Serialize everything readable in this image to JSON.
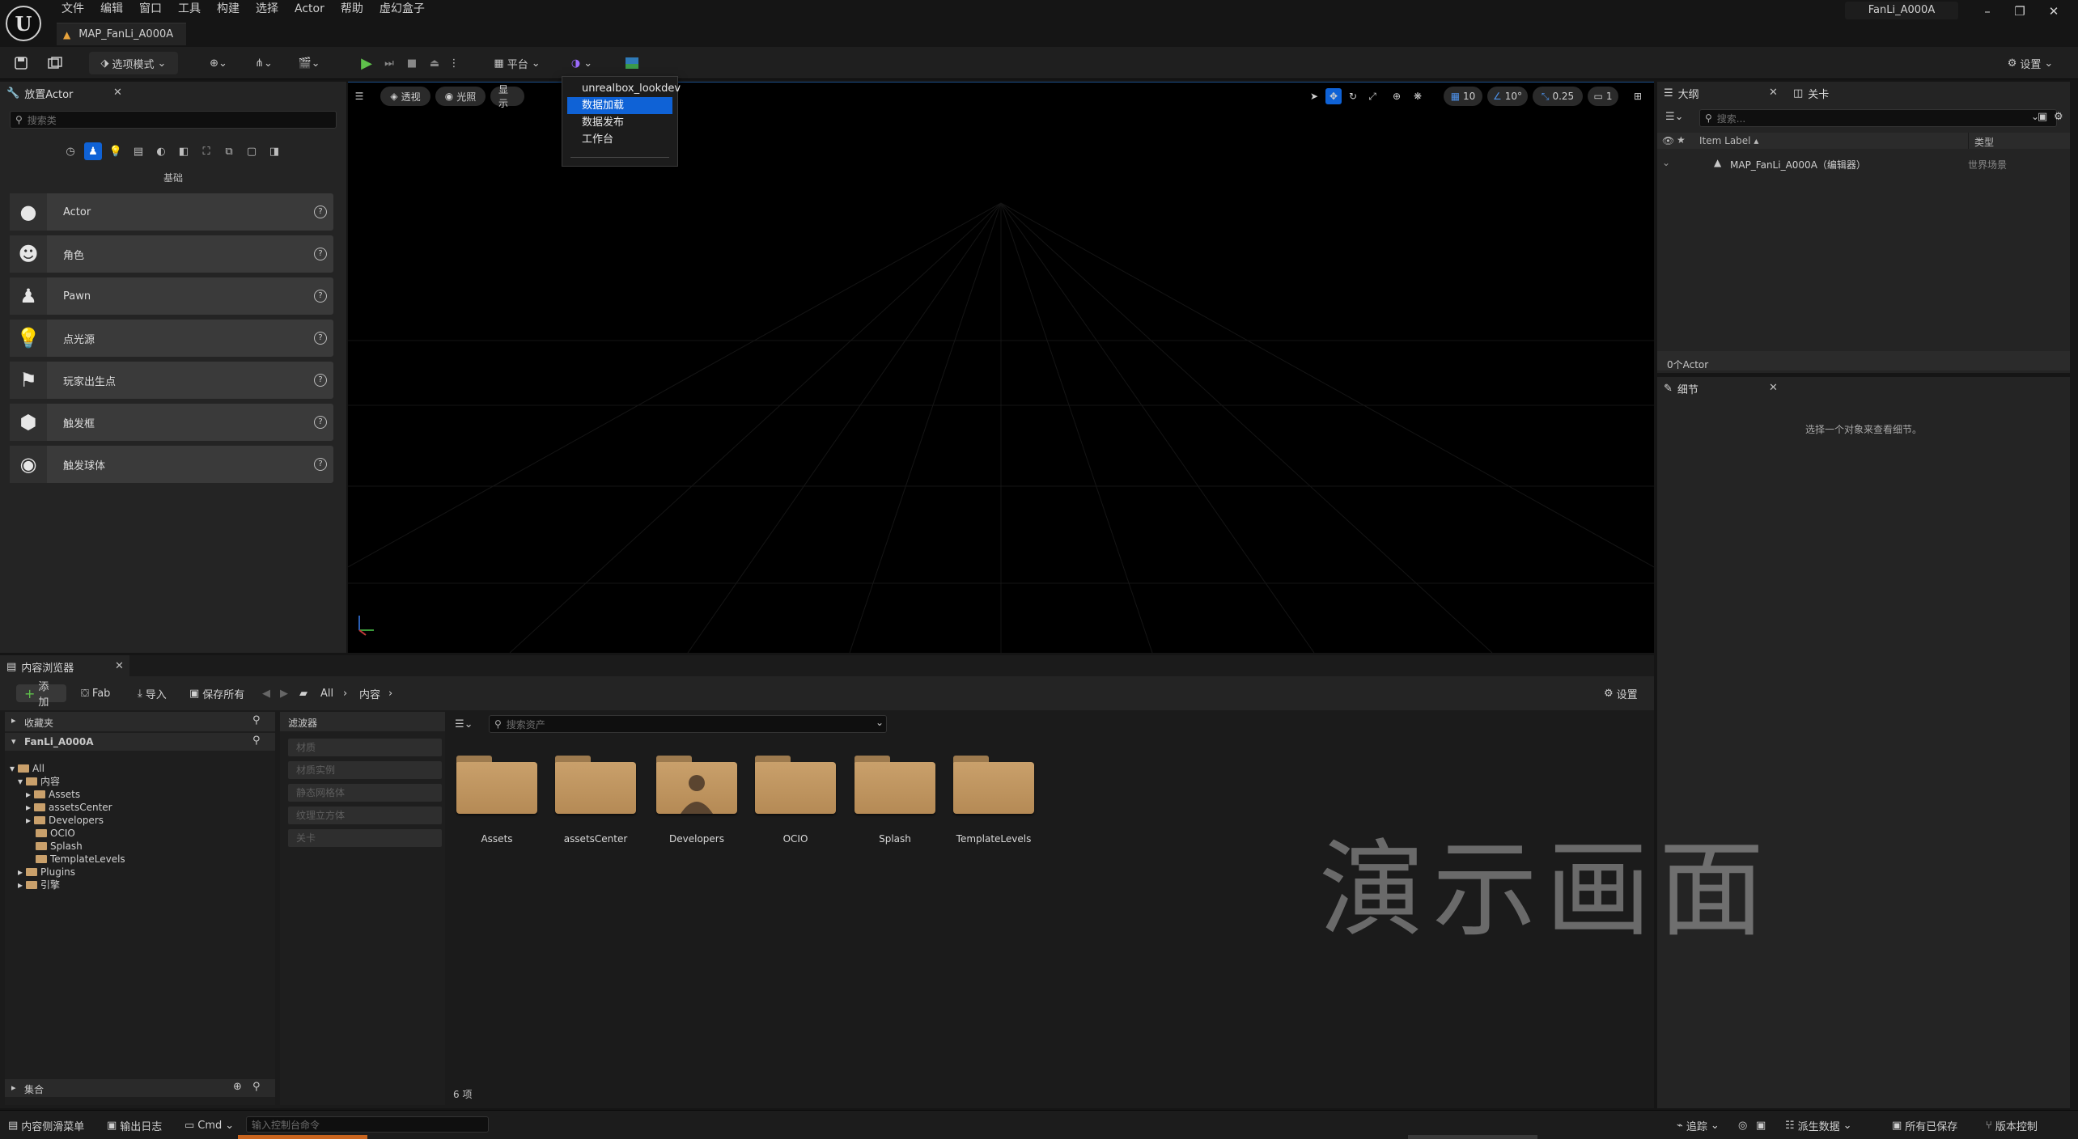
{
  "titlebar": {
    "menu": [
      "文件",
      "编辑",
      "窗口",
      "工具",
      "构建",
      "选择",
      "Actor",
      "帮助",
      "虚幻盒子"
    ],
    "doc_tab": "MAP_FanLi_A000A",
    "project": "FanLi_A000A",
    "win_min": "–",
    "win_restore": "❐",
    "win_close": "✕"
  },
  "toolbar": {
    "mode": "选项模式",
    "platform": "平台",
    "settings": "设置"
  },
  "dropdown": {
    "items": [
      "unrealbox_lookdev",
      "数据加载",
      "数据发布",
      "工作台"
    ],
    "selected_index": 1
  },
  "place_actors": {
    "tab": "放置Actor",
    "search_placeholder": "搜索类",
    "category": "基础",
    "items": [
      "Actor",
      "角色",
      "Pawn",
      "点光源",
      "玩家出生点",
      "触发框",
      "触发球体"
    ]
  },
  "viewport": {
    "perspective": "透视",
    "lighting": "光照",
    "show": "显示",
    "grid_snap": "10",
    "rot_snap": "10°",
    "scale_snap": "0.25",
    "cam_speed": "1"
  },
  "outliner": {
    "tab": "大纲",
    "tab2": "关卡",
    "search_placeholder": "搜索...",
    "col_label": "Item Label ▴",
    "col_type": "类型",
    "row_label": "MAP_FanLi_A000A（编辑器）",
    "row_type": "世界场景",
    "count": "0个Actor"
  },
  "details": {
    "tab": "细节",
    "empty": "选择一个对象来查看细节。"
  },
  "content_browser": {
    "tab": "内容浏览器",
    "add": "添加",
    "fab": "Fab",
    "import": "导入",
    "save_all": "保存所有",
    "path_all": "All",
    "path_content": "内容",
    "settings": "设置",
    "favorites": "收藏夹",
    "project": "FanLi_A000A",
    "filters_title": "滤波器",
    "filters": [
      "材质",
      "材质实例",
      "静态网格体",
      "纹理立方体",
      "关卡"
    ],
    "search_placeholder": "搜索资产",
    "tree": [
      "All",
      "内容",
      "Assets",
      "assetsCenter",
      "Developers",
      "OCIO",
      "Splash",
      "TemplateLevels",
      "Plugins",
      "引擎"
    ],
    "folders": [
      "Assets",
      "assetsCenter",
      "Developers",
      "OCIO",
      "Splash",
      "TemplateLevels"
    ],
    "item_count": "6 项",
    "collections": "集合"
  },
  "watermark": "演示画面",
  "statusbar": {
    "drawer": "内容侧滑菜单",
    "output_log": "输出日志",
    "cmd": "Cmd",
    "console_placeholder": "输入控制台命令",
    "trace": "追踪",
    "derived_data": "派生数据",
    "all_saved": "所有已保存",
    "revision_control": "版本控制"
  }
}
